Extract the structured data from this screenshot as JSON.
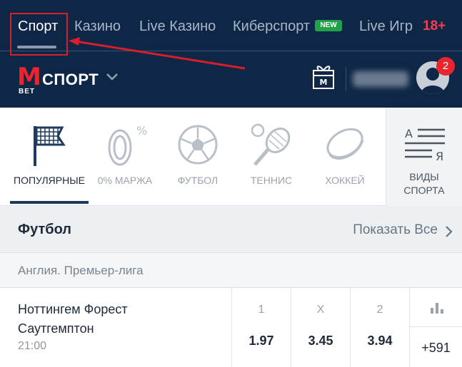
{
  "topnav": {
    "tabs": [
      "Спорт",
      "Казино",
      "Live Казино",
      "Киберспорт",
      "Live Игр"
    ],
    "new_badge": "NEW",
    "age": "18+"
  },
  "header": {
    "logo_letter": "M",
    "logo_sub": "BET",
    "section": "СПОРТ",
    "notifications": "2"
  },
  "sports": [
    {
      "label": "ПОПУЛЯРНЫЕ",
      "icon": "flag-icon"
    },
    {
      "label": "0% МАРЖА",
      "icon": "zero-percent-icon"
    },
    {
      "label": "ФУТБОЛ",
      "icon": "soccer-ball-icon"
    },
    {
      "label": "ТЕННИС",
      "icon": "tennis-icon"
    },
    {
      "label": "ХОККЕЙ",
      "icon": "hockey-puck-icon"
    }
  ],
  "kinds": {
    "line1": "ВИДЫ",
    "line2": "СПОРТА",
    "icon_top": "А",
    "icon_bottom": "Я"
  },
  "section": {
    "title": "Футбол",
    "show_all": "Показать Все"
  },
  "league": "Англия. Премьер-лига",
  "match": {
    "home": "Ноттингем Форест",
    "away": "Саутгемптон",
    "time": "21:00",
    "odds": [
      {
        "label": "1",
        "value": "1.97"
      },
      {
        "label": "X",
        "value": "3.45"
      },
      {
        "label": "2",
        "value": "3.94"
      }
    ],
    "more": "+591"
  },
  "colors": {
    "nav_bg": "#0f2746",
    "accent_red": "#e8242c",
    "new_green": "#23a04a",
    "annotation_red": "#d81e2a"
  }
}
